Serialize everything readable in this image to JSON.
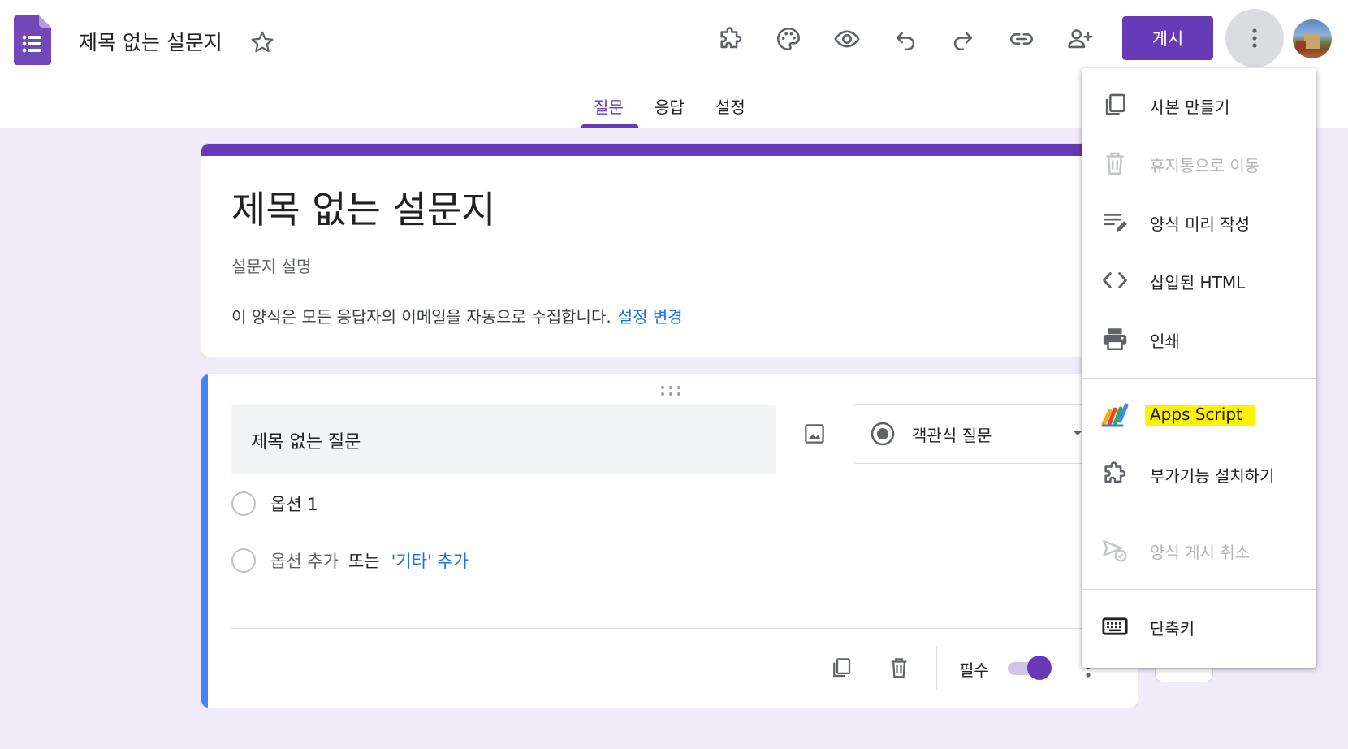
{
  "header": {
    "doc_title": "제목 없는 설문지",
    "publish_label": "게시"
  },
  "tabs": [
    {
      "label": "질문",
      "active": true
    },
    {
      "label": "응답",
      "active": false
    },
    {
      "label": "설정",
      "active": false
    }
  ],
  "form": {
    "title": "제목 없는 설문지",
    "description_placeholder": "설문지 설명",
    "email_note": "이 양식은 모든 응답자의 이메일을 자동으로 수집합니다.",
    "change_settings_link": "설정 변경"
  },
  "question": {
    "title": "제목 없는 질문",
    "type": "객관식 질문",
    "options": [
      "옵션 1"
    ],
    "add_option": "옵션 추가",
    "or_text": "또는",
    "add_other": "'기타' 추가",
    "required_label": "필수",
    "required": true
  },
  "menu": {
    "items": [
      {
        "label": "사본 만들기",
        "icon": "copy-icon",
        "disabled": false
      },
      {
        "label": "휴지통으로 이동",
        "icon": "trash-icon",
        "disabled": true
      },
      {
        "label": "양식 미리 작성",
        "icon": "prefill-icon",
        "disabled": false
      },
      {
        "label": "삽입된 HTML",
        "icon": "code-icon",
        "disabled": false
      },
      {
        "label": "인쇄",
        "icon": "print-icon",
        "disabled": false
      },
      {
        "label": "Apps Script",
        "icon": "apps-script-icon",
        "disabled": false,
        "highlighted": true
      },
      {
        "label": "부가기능 설치하기",
        "icon": "addon-icon",
        "disabled": false
      },
      {
        "label": "양식 게시 취소",
        "icon": "unpublish-icon",
        "disabled": true
      },
      {
        "label": "단축키",
        "icon": "keyboard-icon",
        "disabled": false
      }
    ]
  },
  "colors": {
    "accent": "#673ab7",
    "background": "#f0ebf8",
    "link": "#1a73e8",
    "question_accent": "#4285f4",
    "highlight": "#fff200"
  }
}
